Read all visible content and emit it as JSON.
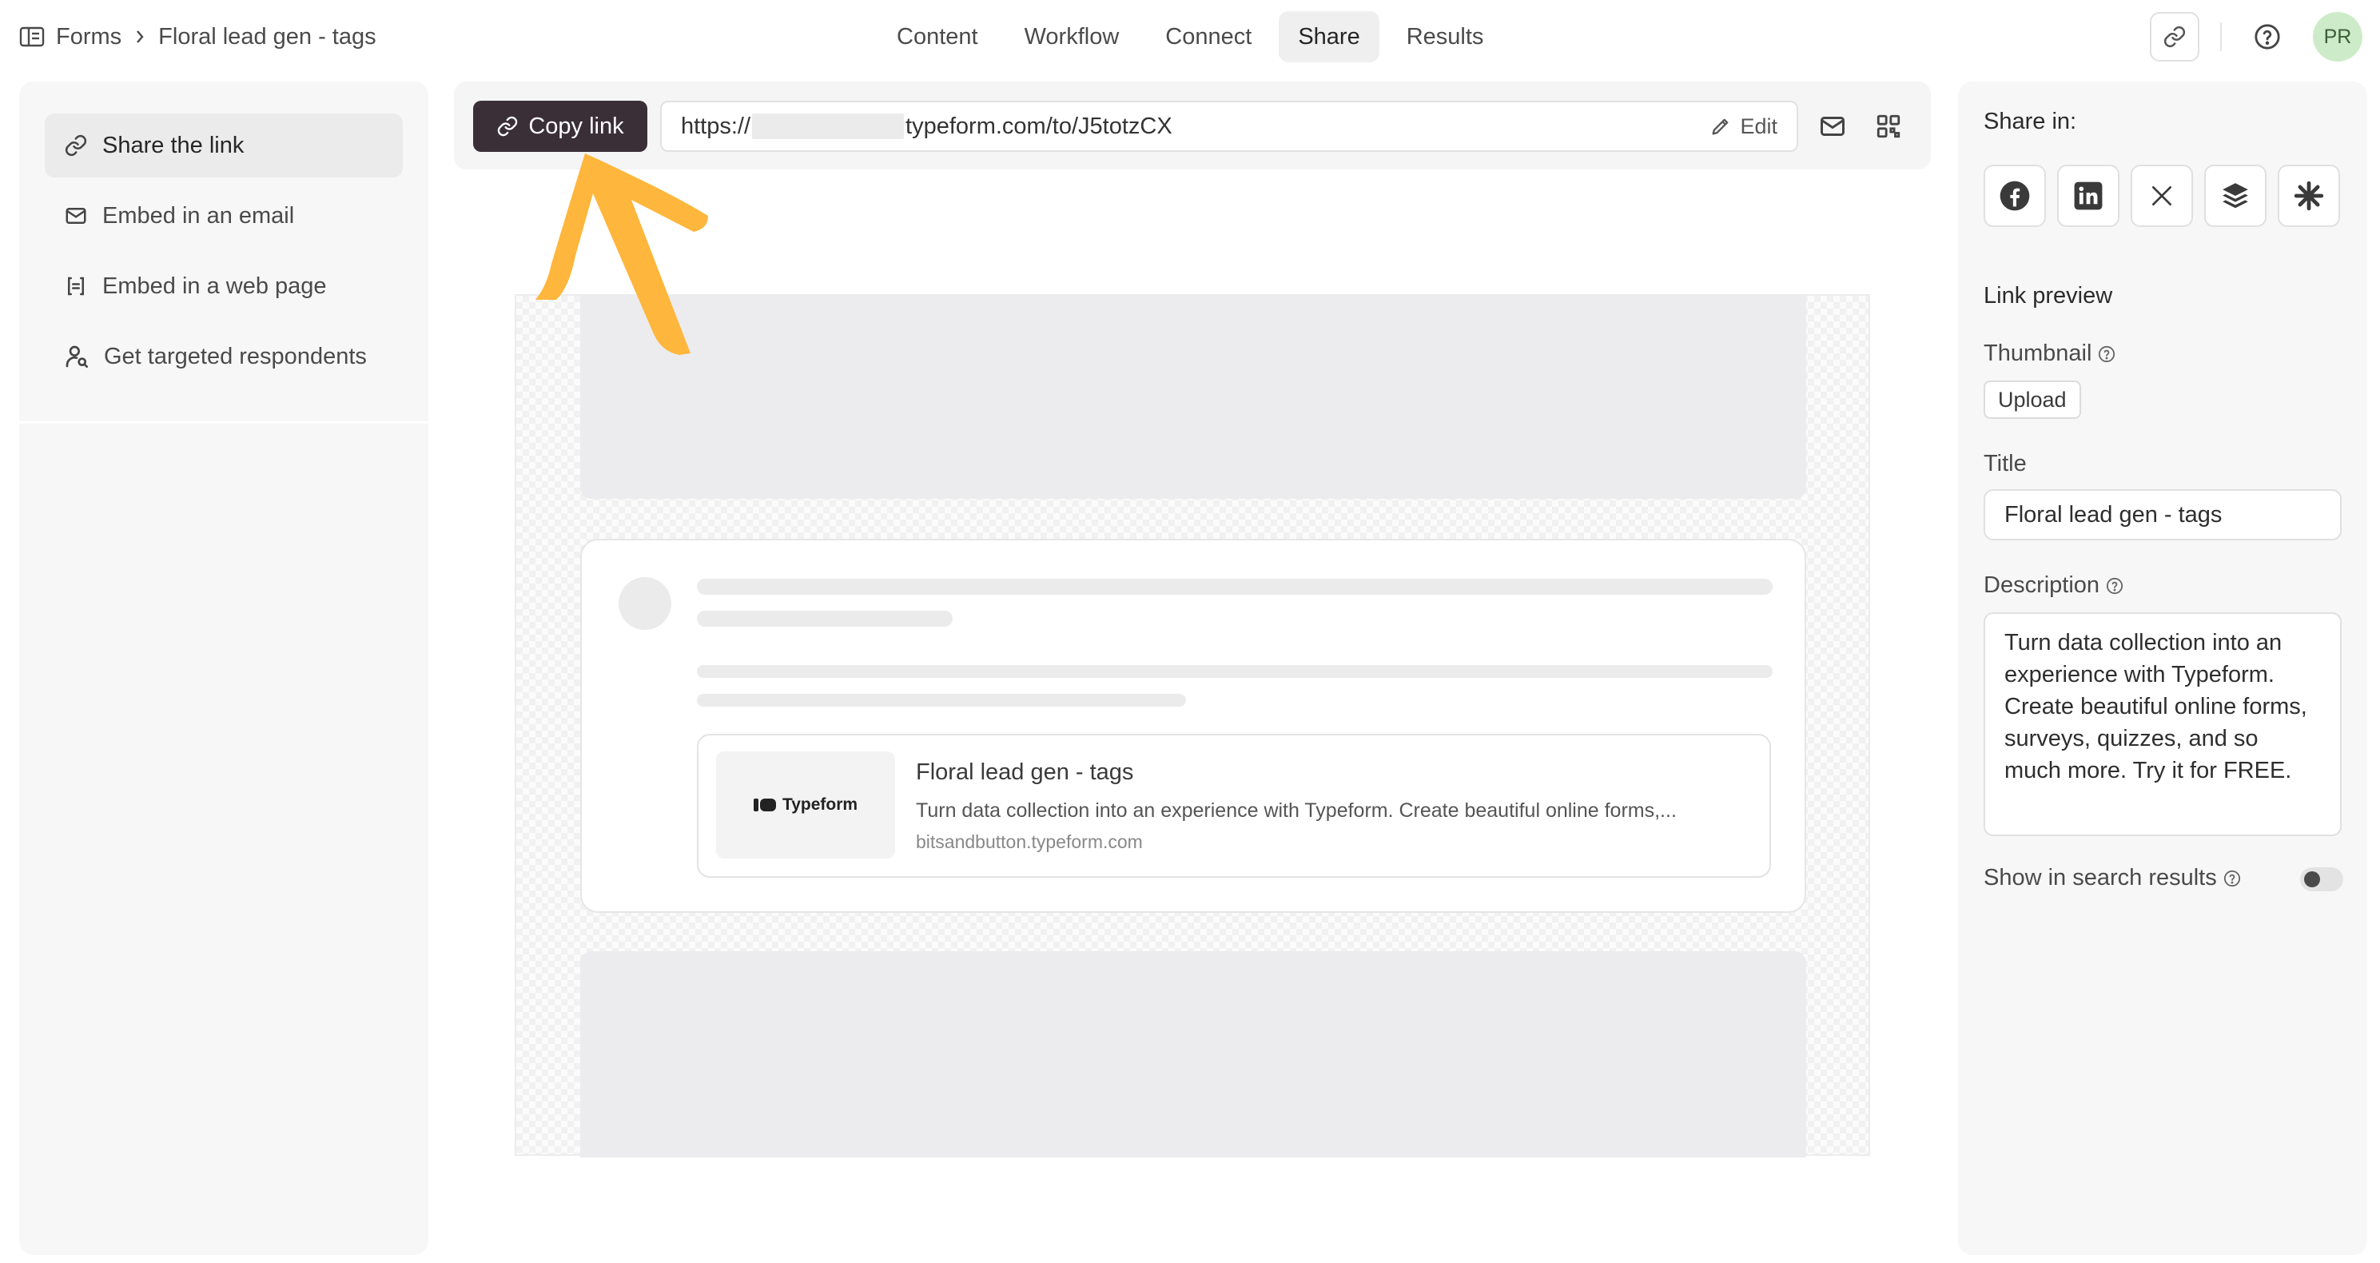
{
  "breadcrumb": {
    "root": "Forms",
    "current": "Floral lead gen - tags"
  },
  "nav": {
    "tabs": [
      "Content",
      "Workflow",
      "Connect",
      "Share",
      "Results"
    ],
    "active": "Share"
  },
  "user": {
    "initials": "PR"
  },
  "sidebar": {
    "items": [
      {
        "label": "Share the link",
        "icon": "link-icon"
      },
      {
        "label": "Embed in an email",
        "icon": "mail-icon"
      },
      {
        "label": "Embed in a web page",
        "icon": "code-bracket-icon"
      },
      {
        "label": "Get targeted respondents",
        "icon": "user-search-icon"
      }
    ],
    "active": "Share the link"
  },
  "linkbar": {
    "copy_label": "Copy link",
    "url_prefix": "https://",
    "url_suffix": "typeform.com/to/J5totzCX",
    "edit_label": "Edit"
  },
  "preview": {
    "card_title": "Floral lead gen - tags",
    "card_description": "Turn data collection into an experience with Typeform. Create beautiful online forms,...",
    "card_url": "bitsandbutton.typeform.com",
    "thumb_logo": "Typeform"
  },
  "right_panel": {
    "share_in_label": "Share in:",
    "socials": [
      "facebook-icon",
      "linkedin-icon",
      "x-icon",
      "buffer-icon",
      "asterisk-icon"
    ],
    "link_preview_label": "Link preview",
    "thumbnail_label": "Thumbnail",
    "upload_label": "Upload",
    "title_label": "Title",
    "title_value": "Floral lead gen - tags",
    "description_label": "Description",
    "description_value": "Turn data collection into an experience with Typeform. Create beautiful online forms, surveys, quizzes, and so much more. Try it for FREE.",
    "search_label": "Show in search results",
    "search_enabled": false
  },
  "colors": {
    "copy_button": "#3a2f37",
    "arrow": "#ffb63c",
    "avatar": "#cdebc8"
  }
}
